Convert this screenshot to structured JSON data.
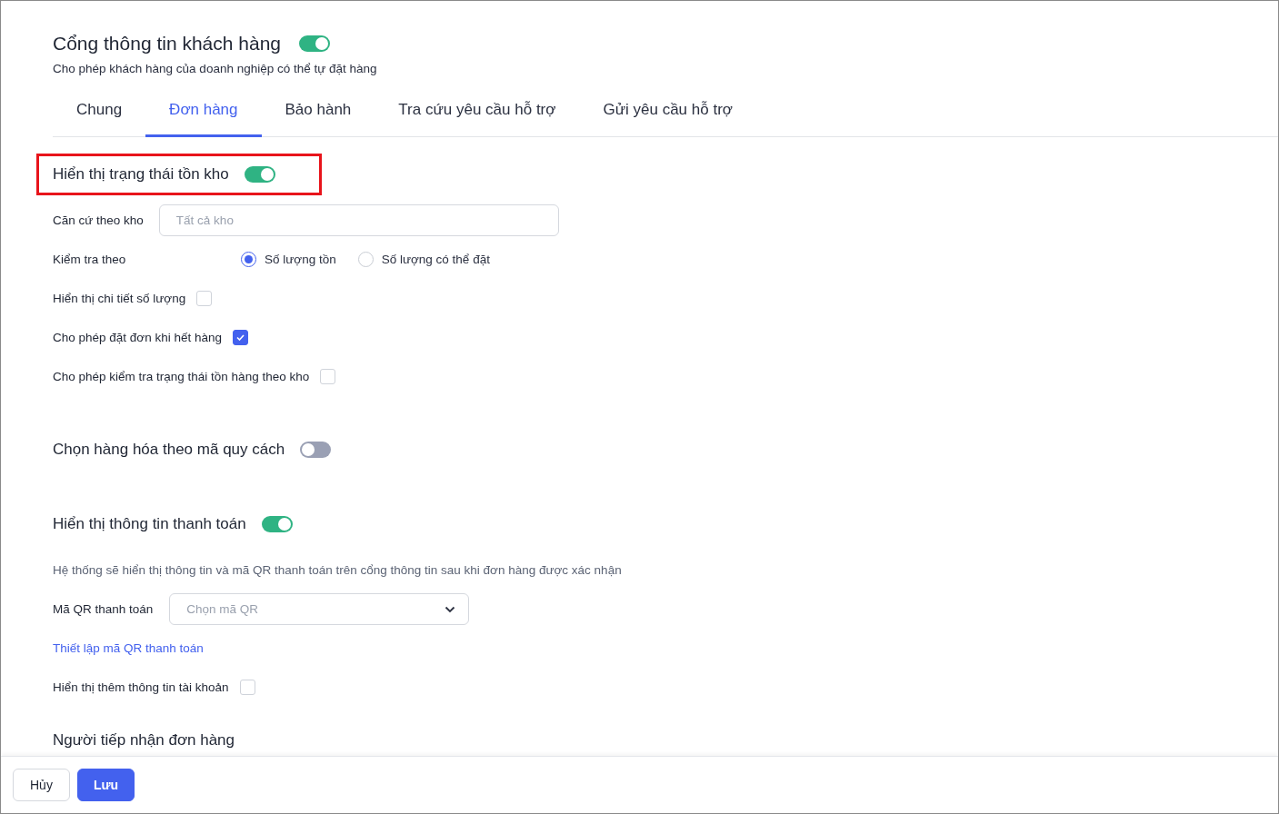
{
  "header": {
    "title": "Cổng thông tin khách hàng",
    "on": true,
    "subtitle": "Cho phép khách hàng của doanh nghiệp có thể tự đặt hàng"
  },
  "tabs": [
    {
      "label": "Chung",
      "selected": false
    },
    {
      "label": "Đơn hàng",
      "selected": true
    },
    {
      "label": "Bảo hành",
      "selected": false
    },
    {
      "label": "Tra cứu yêu cầu hỗ trợ",
      "selected": false
    },
    {
      "label": "Gửi yêu cầu hỗ trợ",
      "selected": false
    }
  ],
  "sections": [
    {
      "title": "Hiển thị trạng thái tồn kho",
      "on": true,
      "highlighted": true,
      "rows": [
        {
          "kind": "select",
          "label": "Căn cứ theo kho",
          "placeholder": "Tất cả kho",
          "dropdown": false
        },
        {
          "kind": "radio",
          "label": "Kiểm tra theo",
          "options": [
            {
              "label": "Số lượng tồn",
              "selected": true
            },
            {
              "label": "Số lượng có thể đặt",
              "selected": false
            }
          ]
        },
        {
          "kind": "checkbox",
          "label": "Hiển thị chi tiết số lượng",
          "checked": false
        },
        {
          "kind": "checkbox",
          "label": "Cho phép đặt đơn khi hết hàng",
          "checked": true
        },
        {
          "kind": "checkbox",
          "label": "Cho phép kiểm tra trạng thái tồn hàng theo kho",
          "checked": false
        }
      ]
    },
    {
      "title": "Chọn hàng hóa theo mã quy cách",
      "on": false,
      "highlighted": false
    },
    {
      "title": "Hiển thị thông tin thanh toán",
      "on": true,
      "highlighted": false,
      "rows": [
        {
          "kind": "note",
          "text": "Hệ thống sẽ hiển thị thông tin và mã QR thanh toán trên cổng thông tin sau khi đơn hàng được xác nhận"
        },
        {
          "kind": "select",
          "label": "Mã QR thanh toán",
          "placeholder": "Chọn mã QR",
          "dropdown": true
        },
        {
          "kind": "link",
          "text": "Thiết lập mã QR thanh toán"
        },
        {
          "kind": "checkbox",
          "label": "Hiển thị thêm thông tin tài khoản",
          "checked": false
        }
      ]
    },
    {
      "title": "Người tiếp nhận đơn hàng",
      "highlighted": false
    }
  ],
  "footer": {
    "buttons": [
      {
        "label": "Hủy",
        "kind": "secondary"
      },
      {
        "label": "Lưu",
        "kind": "primary"
      }
    ]
  }
}
